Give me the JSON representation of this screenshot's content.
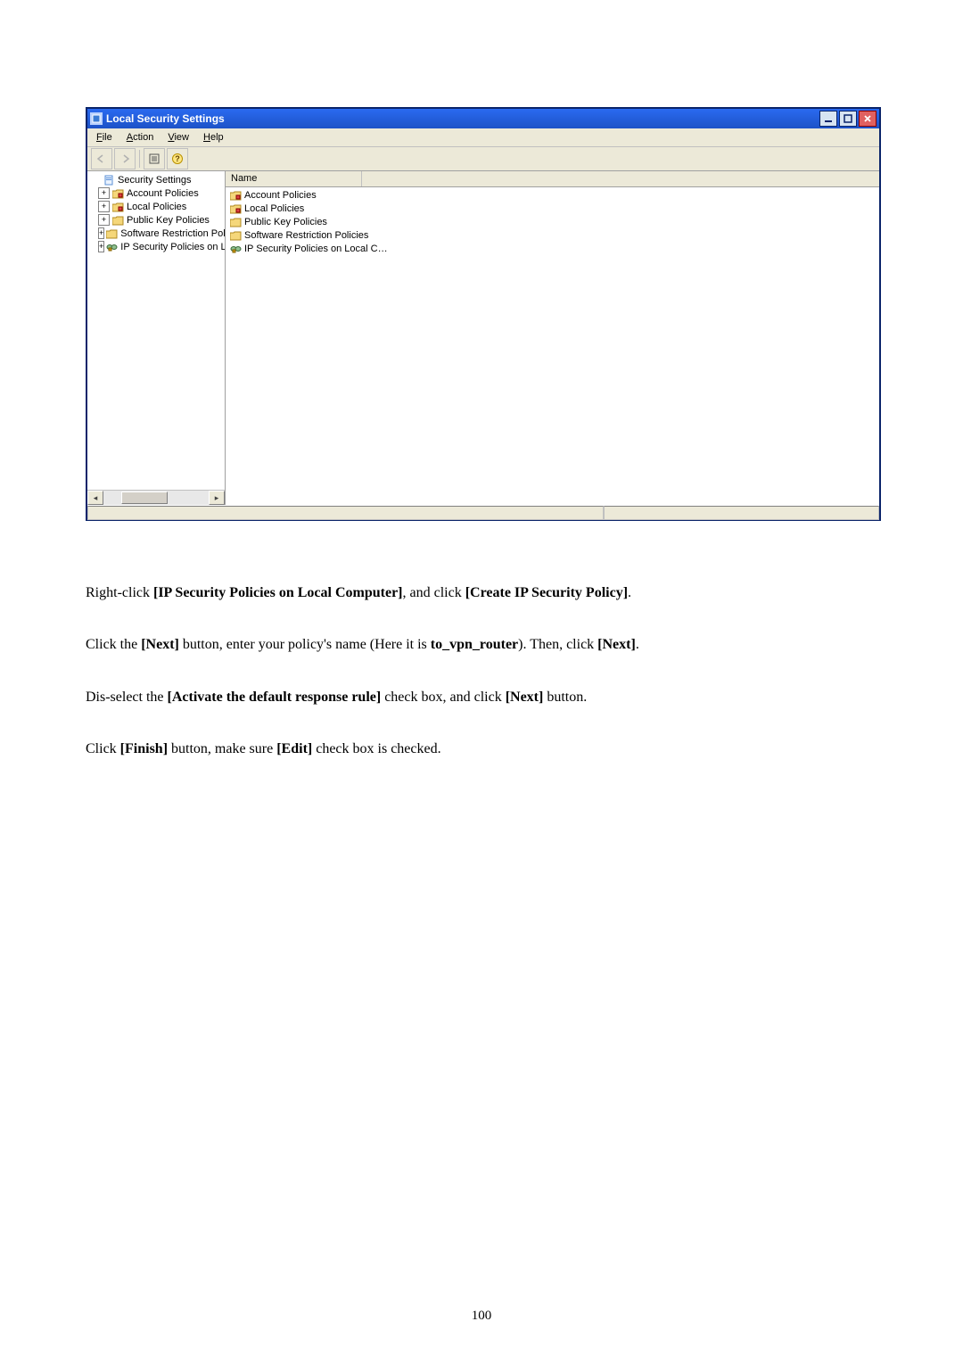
{
  "window": {
    "title": "Local Security Settings",
    "menu": {
      "file": "File",
      "action": "Action",
      "view": "View",
      "help": "Help"
    },
    "tree": {
      "root": "Security Settings",
      "items": [
        {
          "label": "Account Policies",
          "icon": "folder-lock"
        },
        {
          "label": "Local Policies",
          "icon": "folder-lock"
        },
        {
          "label": "Public Key Policies",
          "icon": "folder"
        },
        {
          "label": "Software Restriction Policie",
          "icon": "folder"
        },
        {
          "label": "IP Security Policies on Loca",
          "icon": "ip"
        }
      ]
    },
    "list": {
      "header": "Name",
      "items": [
        {
          "label": "Account Policies",
          "icon": "folder-lock"
        },
        {
          "label": "Local Policies",
          "icon": "folder-lock"
        },
        {
          "label": "Public Key Policies",
          "icon": "folder"
        },
        {
          "label": "Software Restriction Policies",
          "icon": "folder"
        },
        {
          "label": "IP Security Policies on Local C…",
          "icon": "ip"
        }
      ]
    }
  },
  "instructions": {
    "p1a": "Right-click ",
    "p1b": "[IP Security Policies on Local Computer]",
    "p1c": ", and click ",
    "p1d": "[Create IP Security Policy]",
    "p1e": ".",
    "p2a": "Click the ",
    "p2b": "[Next]",
    "p2c": " button, enter your policy's name (Here it is ",
    "p2d": "to_vpn_router",
    "p2e": "). Then, click ",
    "p2f": "[Next]",
    "p2g": ".",
    "p3a": "Dis-select the ",
    "p3b": "[Activate the default response rule]",
    "p3c": " check box, and click ",
    "p3d": "[Next]",
    "p3e": " button.",
    "p4a": "Click ",
    "p4b": "[Finish]",
    "p4c": " button, make sure ",
    "p4d": "[Edit]",
    "p4e": " check box is checked."
  },
  "page_number": "100"
}
